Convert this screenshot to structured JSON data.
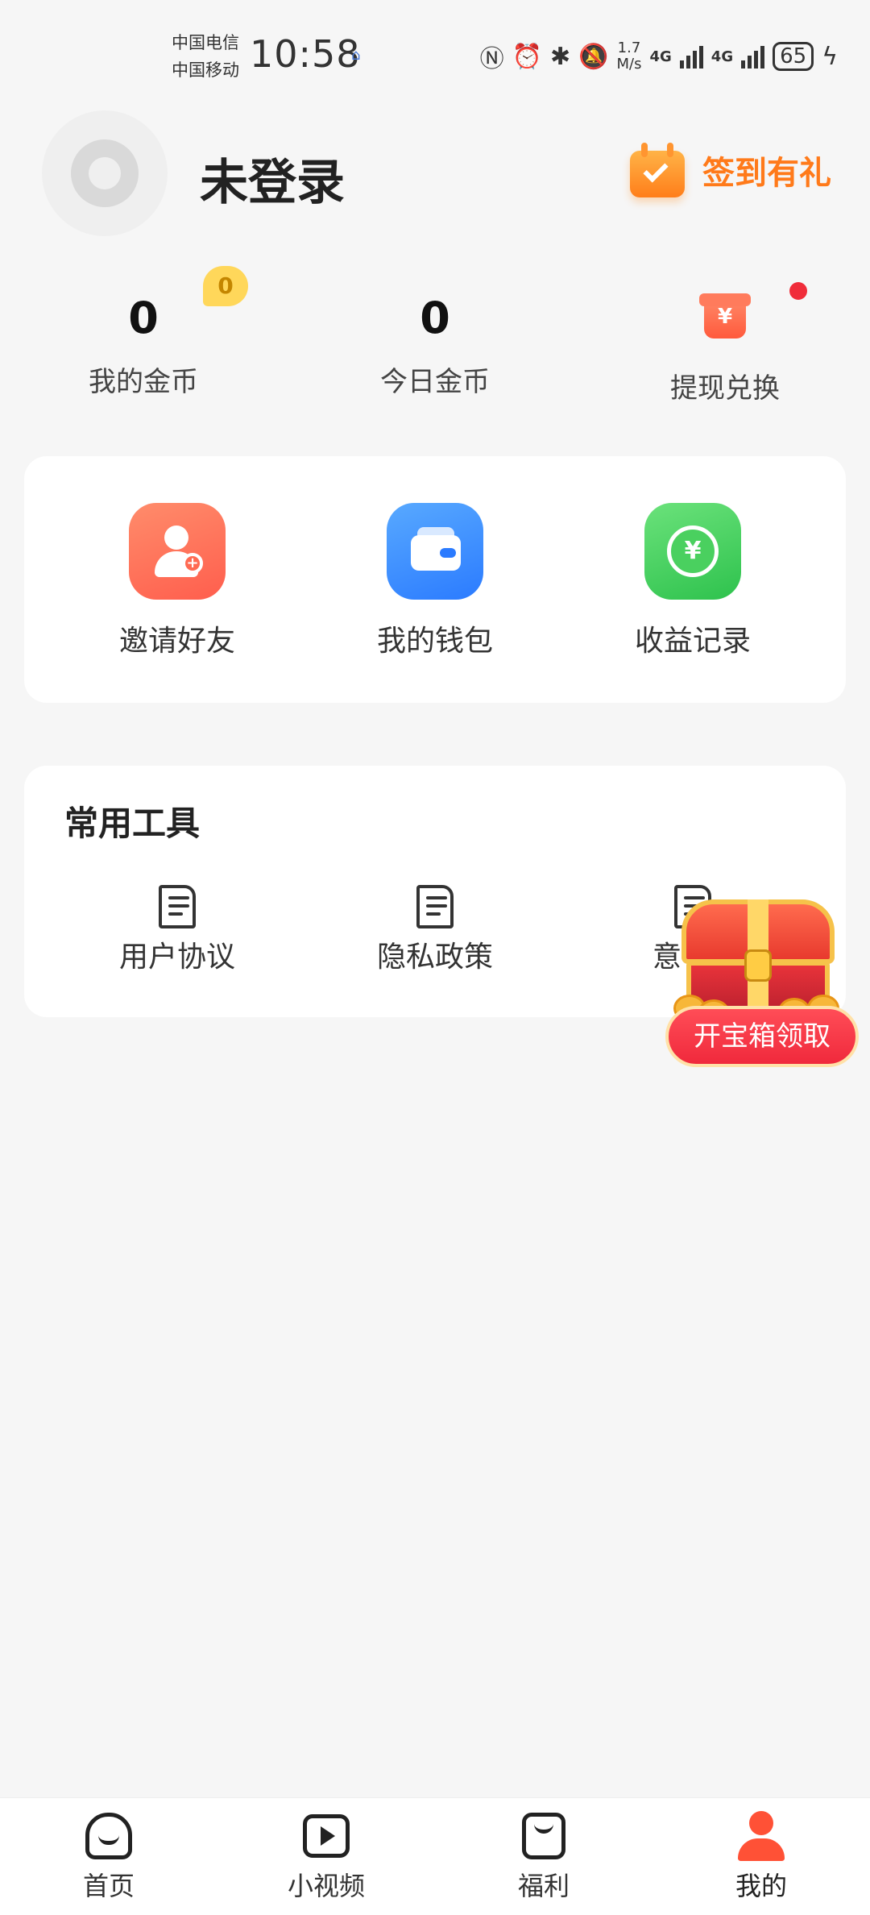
{
  "status_bar": {
    "carrier_1": "中国电信",
    "carrier_2": "中国移动",
    "time": "10:58",
    "speed_value": "1.7",
    "speed_unit": "M/s",
    "net_1": "4G",
    "net_2": "4G",
    "battery": "65"
  },
  "profile": {
    "name": "未登录",
    "checkin_label": "签到有礼"
  },
  "stats": [
    {
      "value": "0",
      "label": "我的金币",
      "badge": "0"
    },
    {
      "value": "0",
      "label": "今日金币"
    },
    {
      "label": "提现兑换"
    }
  ],
  "actions": [
    {
      "label": "邀请好友"
    },
    {
      "label": "我的钱包"
    },
    {
      "label": "收益记录"
    }
  ],
  "tools": {
    "title": "常用工具",
    "items": [
      {
        "label": "用户协议"
      },
      {
        "label": "隐私政策"
      },
      {
        "label": "意"
      }
    ]
  },
  "treasure": {
    "button_label": "开宝箱领取"
  },
  "bottom_nav": [
    {
      "label": "首页"
    },
    {
      "label": "小视频"
    },
    {
      "label": "福利"
    },
    {
      "label": "我的",
      "active": true
    }
  ],
  "colors": {
    "accent_orange": "#ff7a1a",
    "active_red": "#ff5136",
    "badge_yellow": "#ffd75a"
  }
}
